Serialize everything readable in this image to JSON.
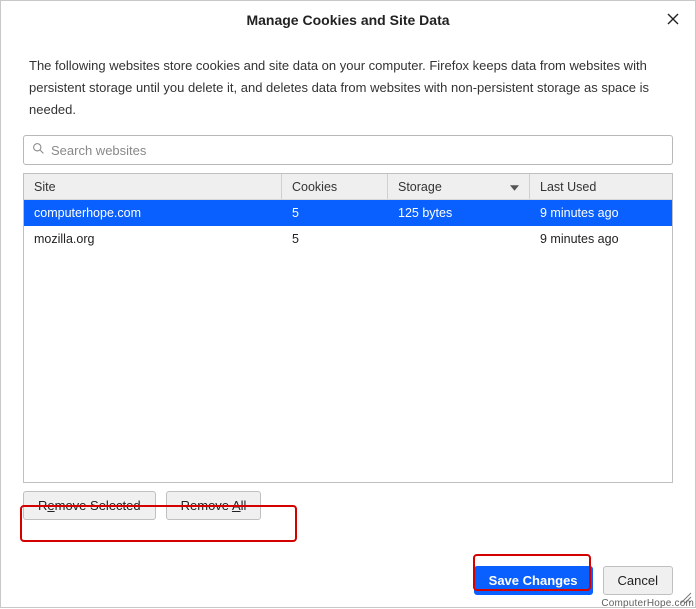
{
  "dialog": {
    "title": "Manage Cookies and Site Data"
  },
  "description": "The following websites store cookies and site data on your computer. Firefox keeps data from websites with persistent storage until you delete it, and deletes data from websites with non-persistent storage as space is needed.",
  "search": {
    "placeholder": "Search websites"
  },
  "table": {
    "headers": {
      "site": "Site",
      "cookies": "Cookies",
      "storage": "Storage",
      "last_used": "Last Used"
    },
    "sort_column": "storage",
    "sort_direction": "desc",
    "rows": [
      {
        "site": "computerhope.com",
        "cookies": "5",
        "storage": "125 bytes",
        "last_used": "9 minutes ago",
        "selected": true
      },
      {
        "site": "mozilla.org",
        "cookies": "5",
        "storage": "",
        "last_used": "9 minutes ago",
        "selected": false
      }
    ]
  },
  "buttons": {
    "remove_selected_pre": "R",
    "remove_selected_m": "e",
    "remove_selected_post": "move Selected",
    "remove_all_pre": "Remove ",
    "remove_all_m": "A",
    "remove_all_post": "ll",
    "save": "Save Changes",
    "cancel": "Cancel"
  },
  "watermark": "ComputerHope.com"
}
